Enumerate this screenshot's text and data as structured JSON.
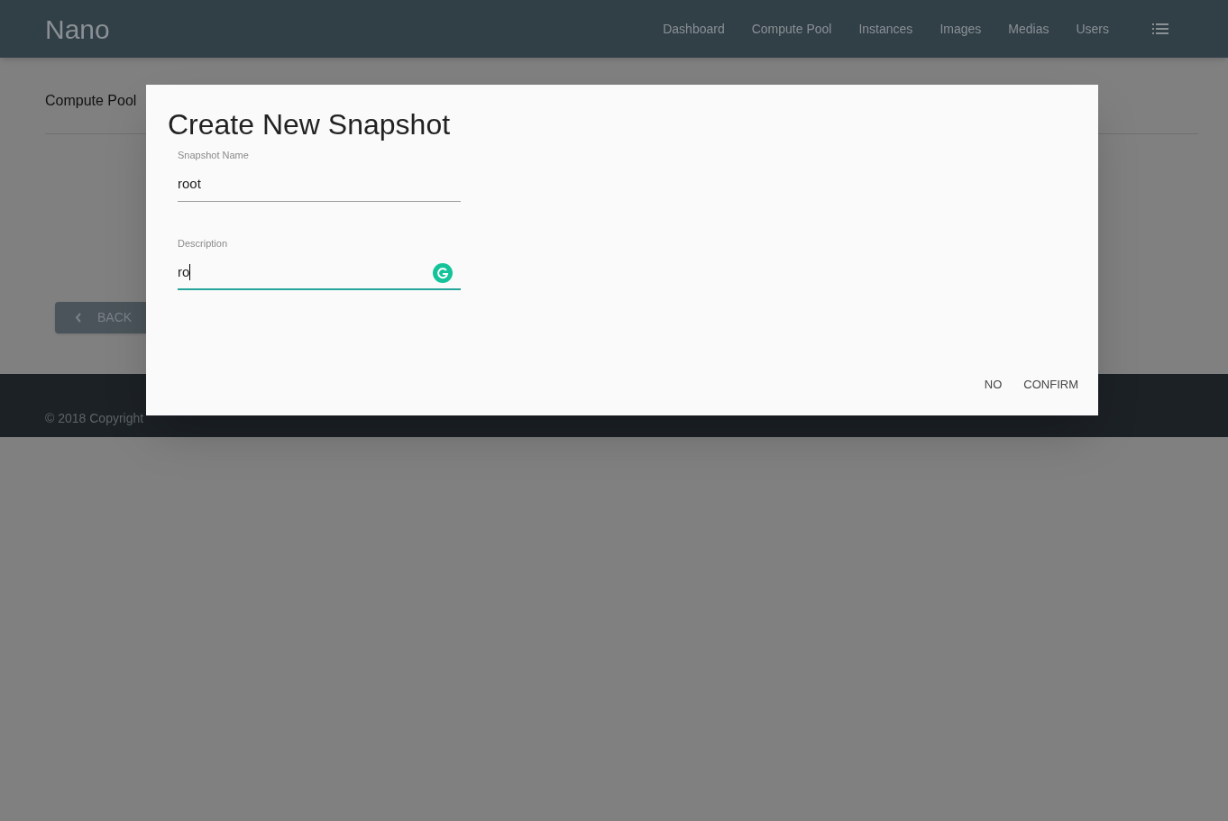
{
  "header": {
    "brand": "Nano",
    "nav": [
      "Dashboard",
      "Compute Pool",
      "Instances",
      "Images",
      "Medias",
      "Users"
    ]
  },
  "page": {
    "breadcrumb": "Compute Pool",
    "back_button": "BACK"
  },
  "footer": {
    "copyright": "© 2018 Copyright"
  },
  "dialog": {
    "title": "Create New Snapshot",
    "fields": [
      {
        "label": "Snapshot Name",
        "value": "root",
        "focused": false
      },
      {
        "label": "Description",
        "value": "ro",
        "focused": true
      }
    ],
    "buttons": [
      "NO",
      "CONFIRM"
    ]
  }
}
